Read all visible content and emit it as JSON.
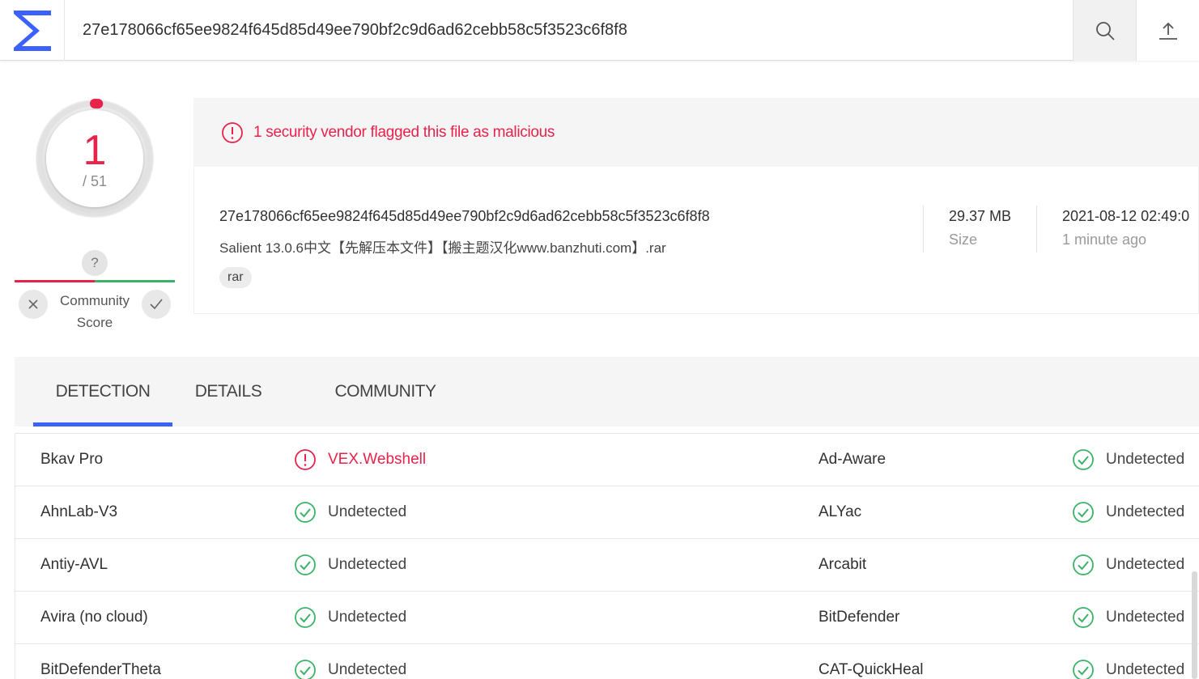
{
  "header": {
    "search_value": "27e178066cf65ee9824f645d85d49ee790bf2c9d6ad62cebb58c5f3523c6f8f8",
    "logo_icon": "sigma-logo-icon",
    "search_icon": "search-icon",
    "upload_icon": "upload-icon"
  },
  "score": {
    "detections": "1",
    "total": "/ 51",
    "detection_fraction": 0.0196,
    "color": "#e8224b"
  },
  "community": {
    "unknown_mark": "?",
    "label_line1": "Community",
    "label_line2": "Score"
  },
  "alert": {
    "text": "1 security vendor flagged this file as malicious",
    "color": "#e8224b"
  },
  "file": {
    "hash": "27e178066cf65ee9824f645d85d49ee790bf2c9d6ad62cebb58c5f3523c6f8f8",
    "name": "Salient 13.0.6中文【先解压本文件】【搬主题汉化www.banzhuti.com】.rar",
    "tag": "rar",
    "size_value": "29.37 MB",
    "size_label": "Size",
    "date_value": "2021-08-12 02:49:0",
    "date_label": "1 minute ago"
  },
  "tabs": [
    {
      "label": "DETECTION",
      "active": true
    },
    {
      "label": "DETAILS",
      "active": false
    },
    {
      "label": "COMMUNITY",
      "active": false
    }
  ],
  "accent_color": "#3b61ff",
  "detections": [
    {
      "left_vendor": "Bkav Pro",
      "left_result": "VEX.Webshell",
      "left_status": "malicious",
      "right_vendor": "Ad-Aware",
      "right_result": "Undetected",
      "right_status": "undetected"
    },
    {
      "left_vendor": "AhnLab-V3",
      "left_result": "Undetected",
      "left_status": "undetected",
      "right_vendor": "ALYac",
      "right_result": "Undetected",
      "right_status": "undetected"
    },
    {
      "left_vendor": "Antiy-AVL",
      "left_result": "Undetected",
      "left_status": "undetected",
      "right_vendor": "Arcabit",
      "right_result": "Undetected",
      "right_status": "undetected"
    },
    {
      "left_vendor": "Avira (no cloud)",
      "left_result": "Undetected",
      "left_status": "undetected",
      "right_vendor": "BitDefender",
      "right_result": "Undetected",
      "right_status": "undetected"
    },
    {
      "left_vendor": "BitDefenderTheta",
      "left_result": "Undetected",
      "left_status": "undetected",
      "right_vendor": "CAT-QuickHeal",
      "right_result": "Undetected",
      "right_status": "undetected"
    }
  ]
}
